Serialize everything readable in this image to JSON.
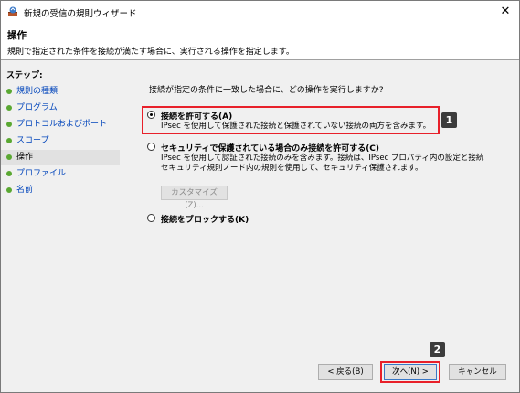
{
  "window": {
    "title": "新規の受信の規則ウィザード",
    "close_glyph": "✕"
  },
  "header": {
    "title": "操作",
    "subtitle": "規則で指定された条件を接続が満たす場合に、実行される操作を指定します。"
  },
  "sidebar": {
    "steps_label": "ステップ:",
    "items": [
      {
        "label": "規則の種類"
      },
      {
        "label": "プログラム"
      },
      {
        "label": "プロトコルおよびポート"
      },
      {
        "label": "スコープ"
      },
      {
        "label": "操作",
        "current": true
      },
      {
        "label": "プロファイル"
      },
      {
        "label": "名前"
      }
    ]
  },
  "main": {
    "question": "接続が指定の条件に一致した場合に、どの操作を実行しますか?",
    "options": [
      {
        "label": "接続を許可する(A)",
        "desc": [
          "IPsec を使用して保護された接続と保護されていない接続の両方を含みます。"
        ],
        "checked": true
      },
      {
        "label": "セキュリティで保護されている場合のみ接続を許可する(C)",
        "desc": [
          "IPsec を使用して認証された接続のみを含みます。接続は、IPsec プロパティ内の設定と接続",
          "セキュリティ規則ノード内の規則を使用して、セキュリティ保護されます。"
        ],
        "checked": false
      },
      {
        "label": "接続をブロックする(K)",
        "desc": [],
        "checked": false
      }
    ],
    "customize_label": "カスタマイズ(Z)..."
  },
  "footer": {
    "back_label": "< 戻る(B)",
    "next_label": "次へ(N) >",
    "cancel_label": "キャンセル"
  },
  "badges": [
    "1",
    "2"
  ]
}
